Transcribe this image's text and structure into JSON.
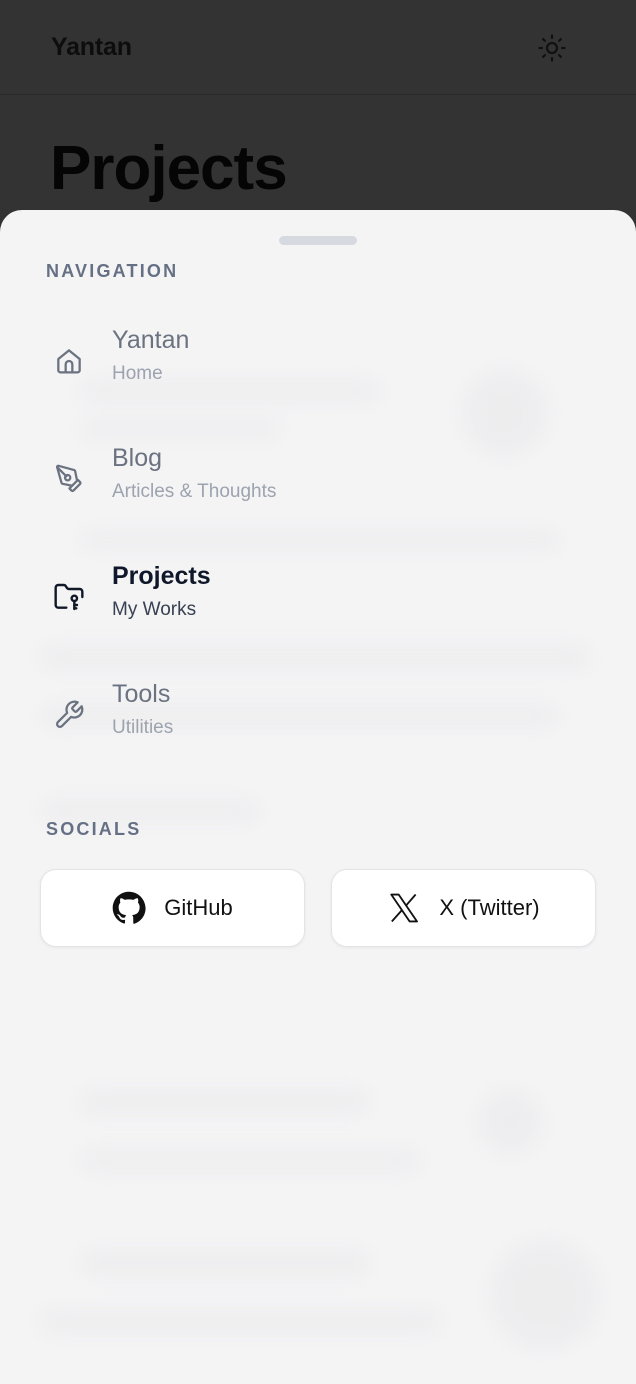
{
  "header": {
    "brand": "Yantan",
    "theme_toggle_icon": "sun-icon"
  },
  "page": {
    "title": "Projects"
  },
  "sheet": {
    "navigation_label": "NAVIGATION",
    "nav_items": [
      {
        "title": "Yantan",
        "subtitle": "Home",
        "icon": "home-icon",
        "active": false
      },
      {
        "title": "Blog",
        "subtitle": "Articles & Thoughts",
        "icon": "pen-tool-icon",
        "active": false
      },
      {
        "title": "Projects",
        "subtitle": "My Works",
        "icon": "folder-key-icon",
        "active": true
      },
      {
        "title": "Tools",
        "subtitle": "Utilities",
        "icon": "wrench-icon",
        "active": false
      }
    ],
    "socials_label": "SOCIALS",
    "socials": [
      {
        "label": "GitHub",
        "icon": "github-icon"
      },
      {
        "label": "X (Twitter)",
        "icon": "x-logo-icon"
      }
    ]
  },
  "colors": {
    "backdrop": "#333333",
    "sheet_background": "#f4f4f5",
    "muted_text": "#6b7280",
    "active_text": "#0f172a",
    "section_label": "#667085"
  }
}
